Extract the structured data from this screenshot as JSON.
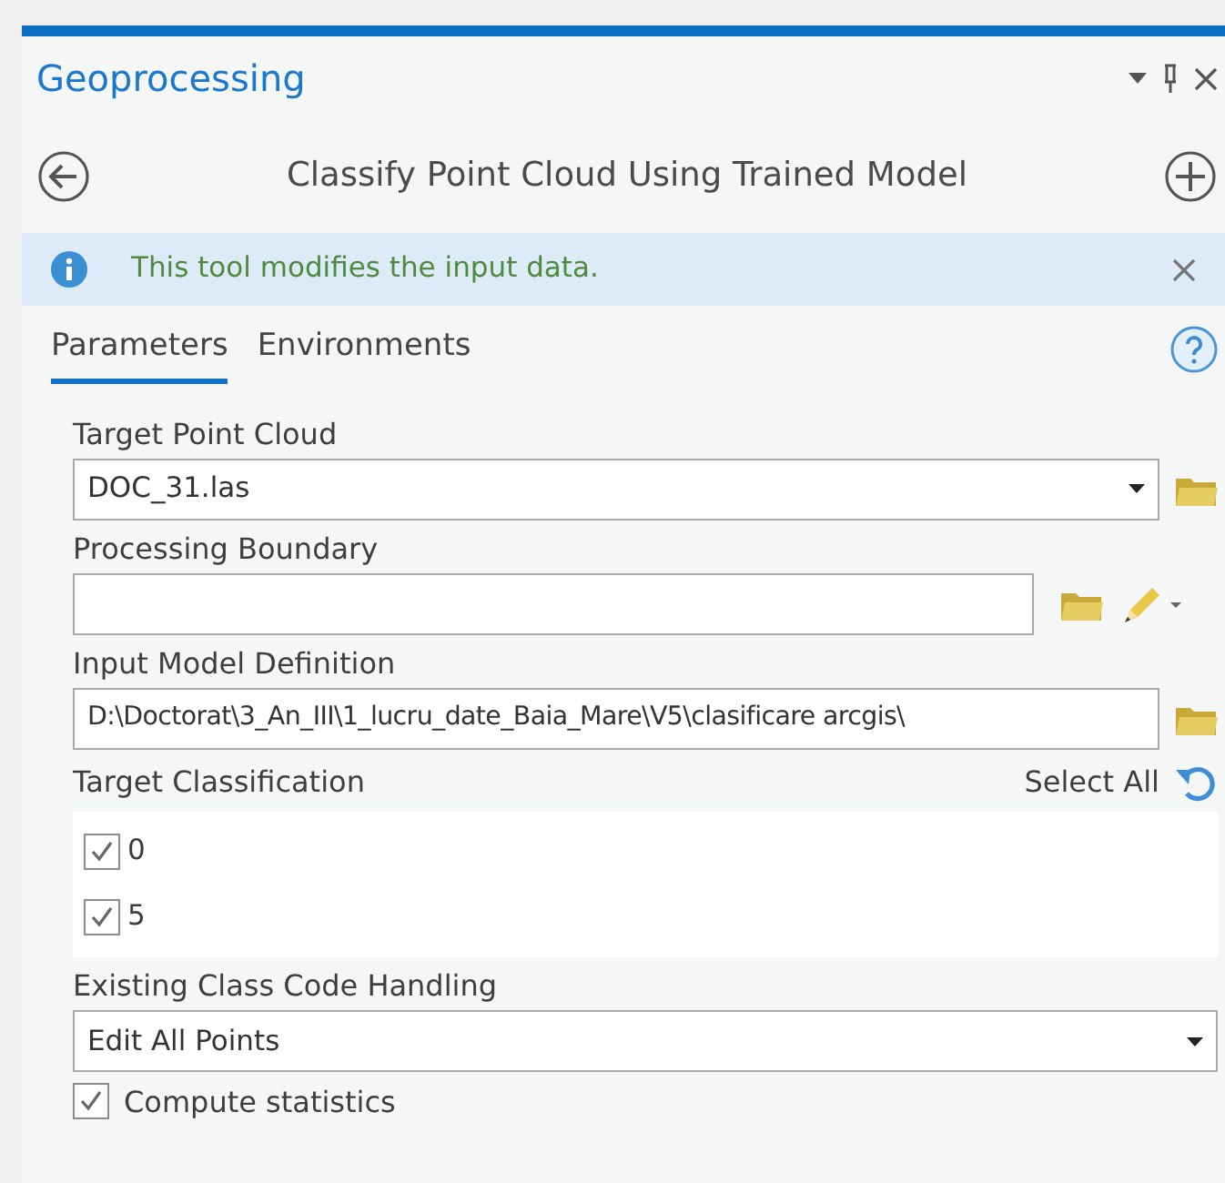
{
  "panel": {
    "title": "Geoprocessing"
  },
  "tool": {
    "title": "Classify Point Cloud Using Trained Model"
  },
  "message": {
    "text": "This tool modifies the input data."
  },
  "tabs": [
    {
      "label": "Parameters",
      "selected": true
    },
    {
      "label": "Environments",
      "selected": false
    }
  ],
  "parameters": [
    {
      "kind": "combo",
      "label": "Target Point Cloud",
      "value": "DOC_31.las"
    },
    {
      "kind": "boundary",
      "label": "Processing Boundary"
    },
    {
      "kind": "path",
      "label": "Input Model Definition",
      "value": "D:\\Doctorat\\3_An_III\\1_lucru_date_Baia_Mare\\V5\\clasificare arcgis\\"
    },
    {
      "kind": "checklist",
      "label": "Target Classification",
      "action": "Select All",
      "items": [
        {
          "label": "0",
          "checked": true
        },
        {
          "label": "5",
          "checked": true
        }
      ]
    },
    {
      "kind": "dropdown",
      "label": "Existing Class Code Handling",
      "value": "Edit All Points"
    },
    {
      "kind": "checkbox",
      "label": "Compute statistics",
      "checked": true
    }
  ]
}
